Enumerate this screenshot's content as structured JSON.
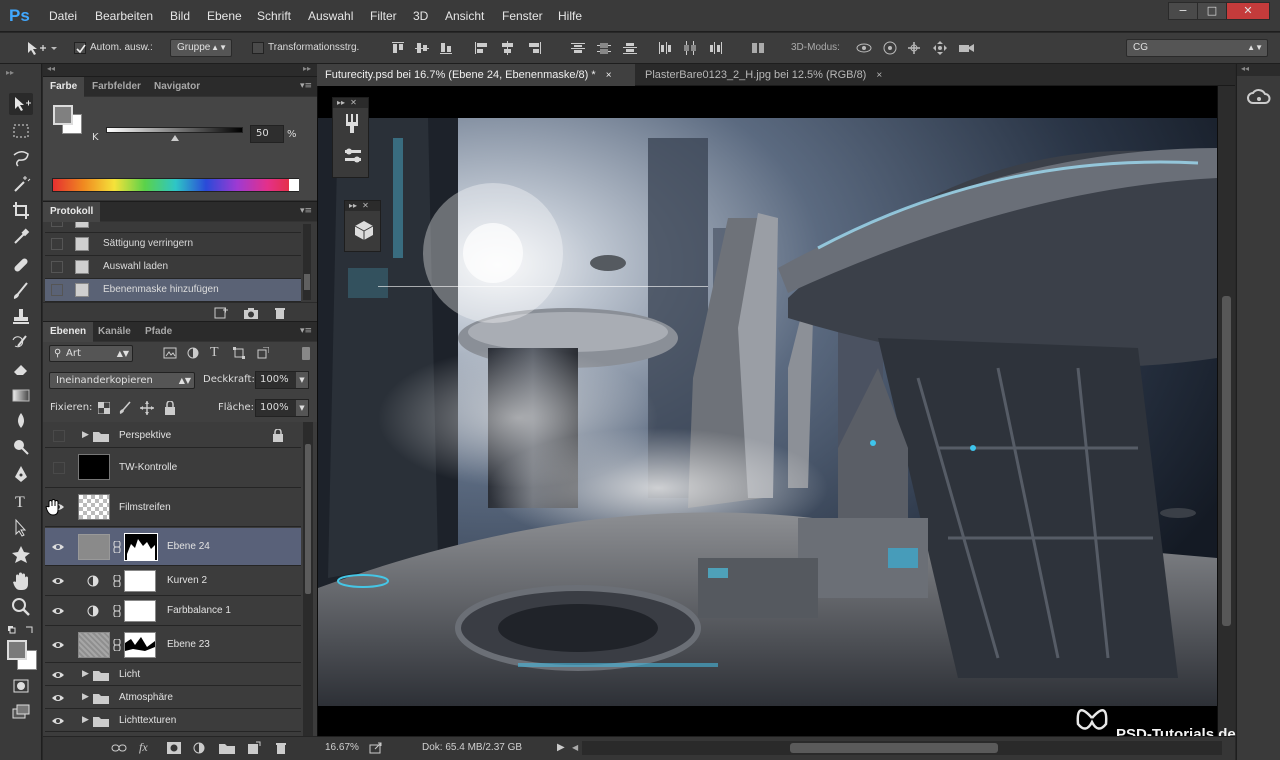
{
  "app": {
    "logo": "Ps"
  },
  "menu": [
    "Datei",
    "Bearbeiten",
    "Bild",
    "Ebene",
    "Schrift",
    "Auswahl",
    "Filter",
    "3D",
    "Ansicht",
    "Fenster",
    "Hilfe"
  ],
  "window_controls": {
    "minimize": "−",
    "maximize": "□",
    "close": "✕"
  },
  "options": {
    "auto_select_label": "Autom. ausw.:",
    "auto_select_value": "Gruppe",
    "transform_label": "Transformationsstrg.",
    "mode3d_label": "3D-Modus:",
    "workspace_value": "CG"
  },
  "color_panel": {
    "tabs": [
      "Farbe",
      "Farbfelder",
      "Navigator"
    ],
    "channel_label": "K",
    "value": "50",
    "unit": "%",
    "slider_fraction": 0.5
  },
  "history_panel": {
    "title": "Protokoll",
    "items": [
      "Sättigung verringern",
      "Auswahl laden",
      "Ebenenmaske hinzufügen"
    ]
  },
  "layers_panel": {
    "tabs": [
      "Ebenen",
      "Kanäle",
      "Pfade"
    ],
    "filter_kind": "Art",
    "blend_mode": "Ineinanderkopieren",
    "opacity_label": "Deckkraft:",
    "opacity_value": "100%",
    "lock_label": "Fixieren:",
    "fill_label": "Fläche:",
    "fill_value": "100%",
    "layers": [
      {
        "name": "Perspektive",
        "type": "group"
      },
      {
        "name": "TW-Kontrolle",
        "type": "layer"
      },
      {
        "name": "Filmstreifen",
        "type": "layer"
      },
      {
        "name": "Ebene 24",
        "type": "layer-mask"
      },
      {
        "name": "Kurven 2",
        "type": "adjustment"
      },
      {
        "name": "Farbbalance 1",
        "type": "adjustment"
      },
      {
        "name": "Ebene 23",
        "type": "layer-mask"
      },
      {
        "name": "Licht",
        "type": "group"
      },
      {
        "name": "Atmosphäre",
        "type": "group"
      },
      {
        "name": "Lichttexturen",
        "type": "group"
      }
    ]
  },
  "documents": [
    {
      "title": "Futurecity.psd bei 16.7% (Ebene 24, Ebenenmaske/8) *",
      "close": "×"
    },
    {
      "title": "PlasterBare0123_2_H.jpg bei 12.5% (RGB/8)",
      "close": "×"
    }
  ],
  "status": {
    "zoom": "16.67%",
    "doc_info": "Dok: 65.4 MB/2.37 GB"
  },
  "watermark": "PSD-Tutorials.de"
}
